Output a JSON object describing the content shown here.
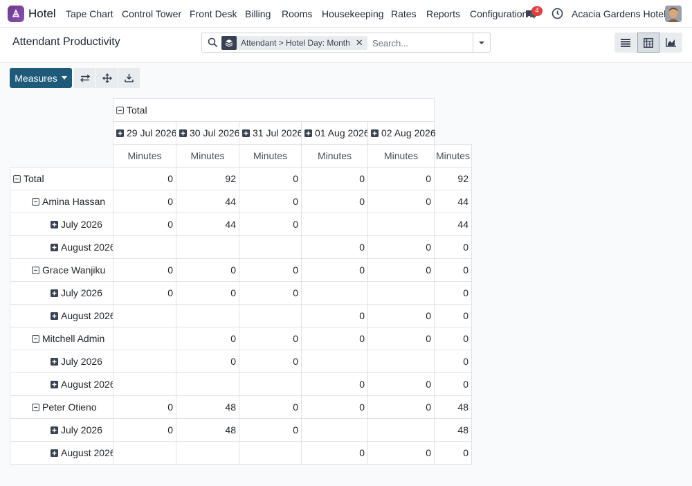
{
  "navbar": {
    "app_name": "Hotel",
    "menu": [
      "Tape Chart",
      "Control Tower",
      "Front Desk",
      "Billing",
      "Rooms",
      "Housekeeping",
      "Rates",
      "Reports",
      "Configuration"
    ],
    "message_count": "4",
    "company": "Acacia Gardens Hotel"
  },
  "control": {
    "title": "Attendant Productivity",
    "facet": "Attendant > Hotel Day: Month",
    "search_placeholder": "Search..."
  },
  "toolbar": {
    "measures_label": "Measures"
  },
  "pivot": {
    "total_label": "Total",
    "measure_label": "Minutes",
    "columns": [
      "29 Jul 2026",
      "30 Jul 2026",
      "31 Jul 2026",
      "01 Aug 2026",
      "02 Aug 2026"
    ],
    "rows": [
      {
        "label": "Total",
        "level": 0,
        "expanded": true,
        "values": [
          "0",
          "92",
          "0",
          "0",
          "0",
          "92"
        ]
      },
      {
        "label": "Amina Hassan",
        "level": 1,
        "expanded": true,
        "values": [
          "0",
          "44",
          "0",
          "0",
          "0",
          "44"
        ]
      },
      {
        "label": "July 2026",
        "level": 2,
        "expanded": false,
        "values": [
          "0",
          "44",
          "0",
          "",
          "",
          "44"
        ]
      },
      {
        "label": "August 2026",
        "level": 2,
        "expanded": false,
        "values": [
          "",
          "",
          "",
          "0",
          "0",
          "0"
        ]
      },
      {
        "label": "Grace Wanjiku",
        "level": 1,
        "expanded": true,
        "values": [
          "0",
          "0",
          "0",
          "0",
          "0",
          "0"
        ]
      },
      {
        "label": "July 2026",
        "level": 2,
        "expanded": false,
        "values": [
          "0",
          "0",
          "0",
          "",
          "",
          "0"
        ]
      },
      {
        "label": "August 2026",
        "level": 2,
        "expanded": false,
        "values": [
          "",
          "",
          "",
          "0",
          "0",
          "0"
        ]
      },
      {
        "label": "Mitchell Admin",
        "level": 1,
        "expanded": true,
        "values": [
          "",
          "0",
          "0",
          "0",
          "0",
          "0"
        ]
      },
      {
        "label": "July 2026",
        "level": 2,
        "expanded": false,
        "values": [
          "",
          "0",
          "0",
          "",
          "",
          "0"
        ]
      },
      {
        "label": "August 2026",
        "level": 2,
        "expanded": false,
        "values": [
          "",
          "",
          "",
          "0",
          "0",
          "0"
        ]
      },
      {
        "label": "Peter Otieno",
        "level": 1,
        "expanded": true,
        "values": [
          "0",
          "48",
          "0",
          "0",
          "0",
          "48"
        ]
      },
      {
        "label": "July 2026",
        "level": 2,
        "expanded": false,
        "values": [
          "0",
          "48",
          "0",
          "",
          "",
          "48"
        ]
      },
      {
        "label": "August 2026",
        "level": 2,
        "expanded": false,
        "values": [
          "",
          "",
          "",
          "0",
          "0",
          "0"
        ]
      }
    ]
  },
  "colors": {
    "primary": "#1f5a7a",
    "app_icon": "#7b449f",
    "badge": "#e0413e"
  }
}
